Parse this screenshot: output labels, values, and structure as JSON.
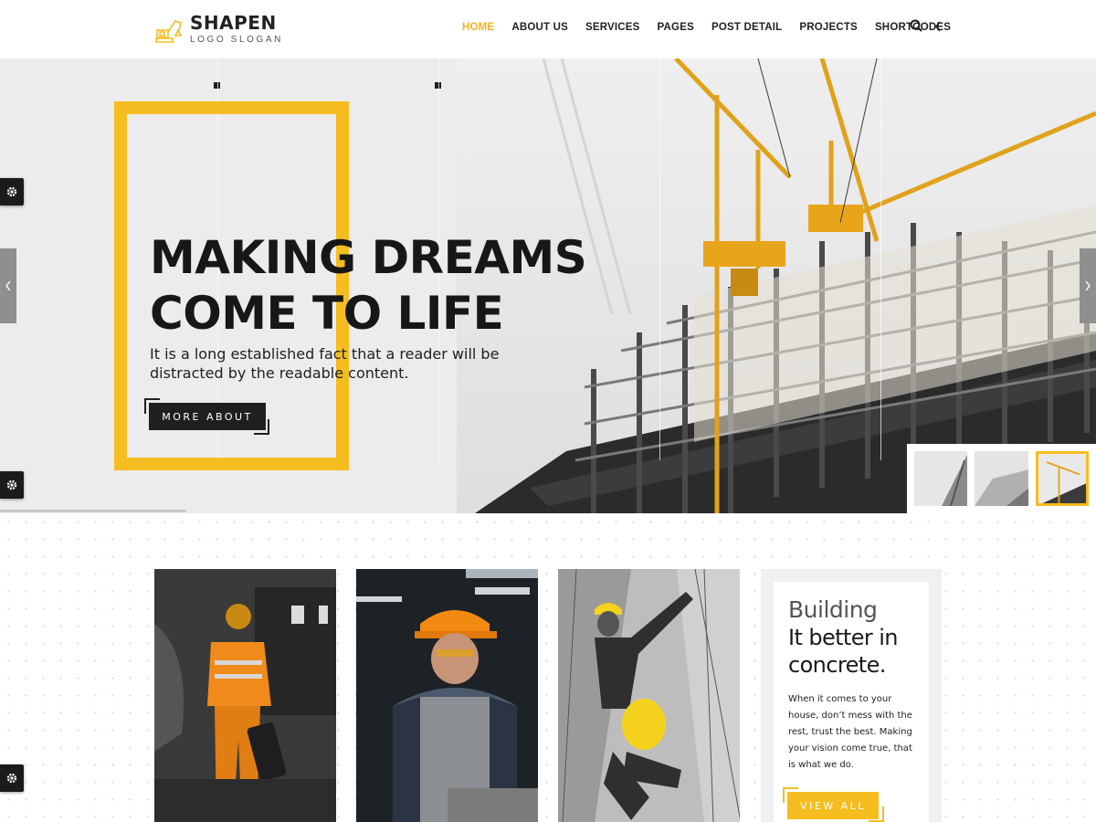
{
  "brand": {
    "name": "SHAPEN",
    "slogan": "LOGO SLOGAN",
    "accent": "#f5bd1f",
    "dark": "#1f1f1f"
  },
  "nav": {
    "items": [
      {
        "label": "HOME",
        "active": true
      },
      {
        "label": "ABOUT US"
      },
      {
        "label": "SERVICES"
      },
      {
        "label": "PAGES"
      },
      {
        "label": "POST DETAIL"
      },
      {
        "label": "PROJECTS"
      },
      {
        "label": "SHORTCODES"
      }
    ],
    "icons": [
      "search-icon",
      "chevron-left-icon"
    ]
  },
  "hero": {
    "title_line1": "MAKING DREAMS",
    "title_line2": "COME TO LIFE",
    "text": "It is a long established fact that a reader will be distracted by the readable content.",
    "button": "MORE ABOUT",
    "slides": 3,
    "active_slide": 3
  },
  "promo": {
    "light": "Building",
    "bold": "It better in concrete.",
    "text": "When it comes to your house, don’t mess with the rest, trust the best. Making your vision come true, that is what we do.",
    "button": "VIEW ALL"
  }
}
